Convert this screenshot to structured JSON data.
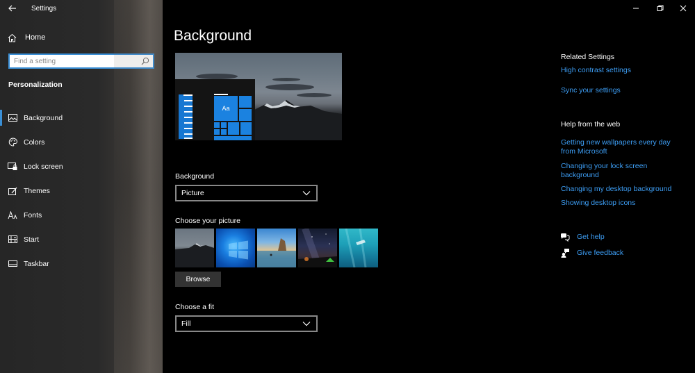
{
  "app": {
    "title": "Settings"
  },
  "sidebar": {
    "home_label": "Home",
    "search_placeholder": "Find a setting",
    "section_title": "Personalization",
    "items": [
      {
        "label": "Background",
        "icon": "picture-icon",
        "active": true
      },
      {
        "label": "Colors",
        "icon": "palette-icon",
        "active": false
      },
      {
        "label": "Lock screen",
        "icon": "lock-screen-icon",
        "active": false
      },
      {
        "label": "Themes",
        "icon": "themes-icon",
        "active": false
      },
      {
        "label": "Fonts",
        "icon": "fonts-icon",
        "active": false
      },
      {
        "label": "Start",
        "icon": "start-icon",
        "active": false
      },
      {
        "label": "Taskbar",
        "icon": "taskbar-icon",
        "active": false
      }
    ]
  },
  "main": {
    "title": "Background",
    "preview_tile_label": "Aa",
    "background_label": "Background",
    "background_value": "Picture",
    "choose_picture_label": "Choose your picture",
    "browse_label": "Browse",
    "fit_label": "Choose a fit",
    "fit_value": "Fill"
  },
  "related": {
    "heading": "Related Settings",
    "links": [
      "High contrast settings",
      "Sync your settings"
    ]
  },
  "help": {
    "heading": "Help from the web",
    "links": [
      "Getting new wallpapers every day from Microsoft",
      "Changing your lock screen background",
      "Changing my desktop background",
      "Showing desktop icons"
    ],
    "get_help": "Get help",
    "give_feedback": "Give feedback"
  },
  "colors": {
    "accent": "#0078d7",
    "link": "#3d9ef5"
  }
}
